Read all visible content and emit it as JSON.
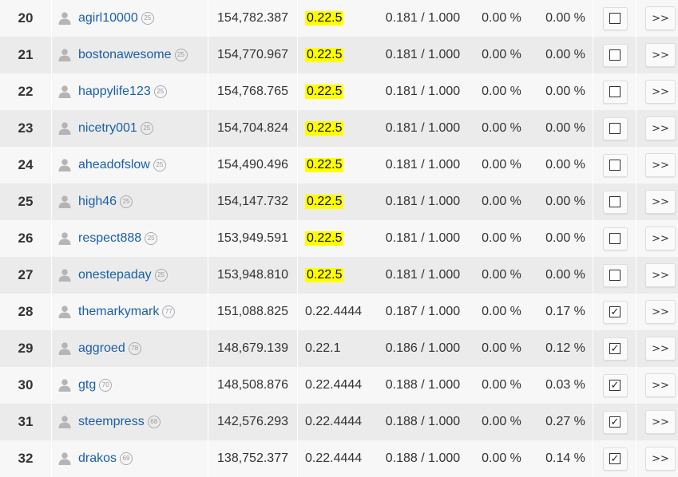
{
  "colors": {
    "link": "#1a5fa6",
    "highlight": "#ffff00",
    "row_light": "#f7f7f7",
    "row_dark": "#ebebeb"
  },
  "icons": {
    "user": "person-icon",
    "vote_unchecked": "checkbox-empty-icon",
    "vote_checked": "checkbox-checked-icon"
  },
  "rows": [
    {
      "rank": "20",
      "name": "agirl10000",
      "rep": "25",
      "vests": "154,782.387",
      "version": "0.22.5",
      "highlight": true,
      "params": "0.181 / 1.000",
      "missed": "0.00 %",
      "missed2": "0.00 %",
      "voted": false,
      "go": ">>"
    },
    {
      "rank": "21",
      "name": "bostonawesome",
      "rep": "25",
      "vests": "154,770.967",
      "version": "0.22.5",
      "highlight": true,
      "params": "0.181 / 1.000",
      "missed": "0.00 %",
      "missed2": "0.00 %",
      "voted": false,
      "go": ">>"
    },
    {
      "rank": "22",
      "name": "happylife123",
      "rep": "25",
      "vests": "154,768.765",
      "version": "0.22.5",
      "highlight": true,
      "params": "0.181 / 1.000",
      "missed": "0.00 %",
      "missed2": "0.00 %",
      "voted": false,
      "go": ">>"
    },
    {
      "rank": "23",
      "name": "nicetry001",
      "rep": "25",
      "vests": "154,704.824",
      "version": "0.22.5",
      "highlight": true,
      "params": "0.181 / 1.000",
      "missed": "0.00 %",
      "missed2": "0.00 %",
      "voted": false,
      "go": ">>"
    },
    {
      "rank": "24",
      "name": "aheadofslow",
      "rep": "25",
      "vests": "154,490.496",
      "version": "0.22.5",
      "highlight": true,
      "params": "0.181 / 1.000",
      "missed": "0.00 %",
      "missed2": "0.00 %",
      "voted": false,
      "go": ">>"
    },
    {
      "rank": "25",
      "name": "high46",
      "rep": "25",
      "vests": "154,147.732",
      "version": "0.22.5",
      "highlight": true,
      "params": "0.181 / 1.000",
      "missed": "0.00 %",
      "missed2": "0.00 %",
      "voted": false,
      "go": ">>"
    },
    {
      "rank": "26",
      "name": "respect888",
      "rep": "25",
      "vests": "153,949.591",
      "version": "0.22.5",
      "highlight": true,
      "params": "0.181 / 1.000",
      "missed": "0.00 %",
      "missed2": "0.00 %",
      "voted": false,
      "go": ">>"
    },
    {
      "rank": "27",
      "name": "onestepaday",
      "rep": "25",
      "vests": "153,948.810",
      "version": "0.22.5",
      "highlight": true,
      "params": "0.181 / 1.000",
      "missed": "0.00 %",
      "missed2": "0.00 %",
      "voted": false,
      "go": ">>"
    },
    {
      "rank": "28",
      "name": "themarkymark",
      "rep": "77",
      "vests": "151,088.825",
      "version": "0.22.4444",
      "highlight": false,
      "params": "0.187 / 1.000",
      "missed": "0.00 %",
      "missed2": "0.17 %",
      "voted": true,
      "go": ">>"
    },
    {
      "rank": "29",
      "name": "aggroed",
      "rep": "78",
      "vests": "148,679.139",
      "version": "0.22.1",
      "highlight": false,
      "params": "0.186 / 1.000",
      "missed": "0.00 %",
      "missed2": "0.12 %",
      "voted": true,
      "go": ">>"
    },
    {
      "rank": "30",
      "name": "gtg",
      "rep": "70",
      "vests": "148,508.876",
      "version": "0.22.4444",
      "highlight": false,
      "params": "0.188 / 1.000",
      "missed": "0.00 %",
      "missed2": "0.03 %",
      "voted": true,
      "go": ">>"
    },
    {
      "rank": "31",
      "name": "steempress",
      "rep": "68",
      "vests": "142,576.293",
      "version": "0.22.4444",
      "highlight": false,
      "params": "0.188 / 1.000",
      "missed": "0.00 %",
      "missed2": "0.27 %",
      "voted": true,
      "go": ">>"
    },
    {
      "rank": "32",
      "name": "drakos",
      "rep": "69",
      "vests": "138,752.377",
      "version": "0.22.4444",
      "highlight": false,
      "params": "0.188 / 1.000",
      "missed": "0.00 %",
      "missed2": "0.14 %",
      "voted": true,
      "go": ">>"
    }
  ]
}
